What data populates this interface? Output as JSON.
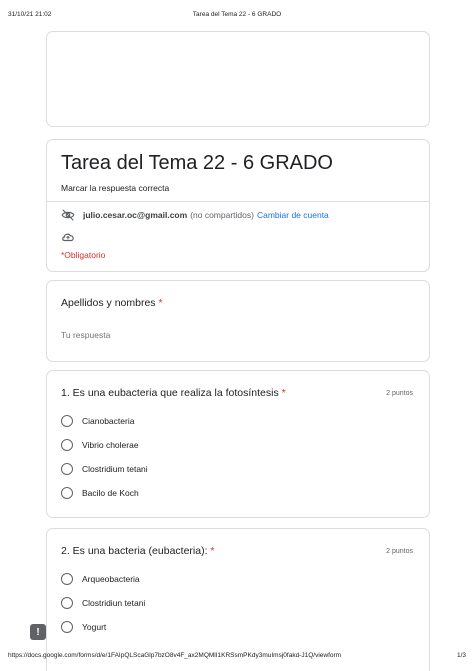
{
  "print_header": {
    "datetime": "31/10/21 21:02",
    "doc_title": "Tarea del Tema 22 - 6 GRADO"
  },
  "form": {
    "title": "Tarea del Tema 22 - 6 GRADO",
    "description": "Marcar la respuesta correcta",
    "account_email": "julio.cesar.oc@gmail.com",
    "not_shared": "(no compartidos)",
    "switch_account": "Cambiar de cuenta",
    "required_note": "*Obligatorio"
  },
  "questions": [
    {
      "title": "Apellidos y nombres",
      "required_mark": "*",
      "placeholder": "Tu respuesta"
    },
    {
      "title": "1. Es una eubacteria que realiza la fotosíntesis",
      "required_mark": "*",
      "points": "2 puntos",
      "options": [
        "Cianobacteria",
        "Vibrio cholerae",
        "Clostridium tetani",
        "Bacilo de Koch"
      ]
    },
    {
      "title": "2. Es una bacteria (eubacteria):",
      "required_mark": "*",
      "points": "2 puntos",
      "options": [
        "Arqueobacteria",
        "Clostridiun tetani",
        "Yogurt"
      ]
    }
  ],
  "print_footer": {
    "url": "https://docs.google.com/forms/d/e/1FAIpQLScaGlp7bzO8v4F_ax2MQMlI1KRSsmPKdy3muImsj0fakd-J1Q/viewform",
    "page": "1/3"
  },
  "icons": {
    "email_visibility": "eye-off-icon",
    "save_status": "cloud-icon",
    "feedback": "feedback-icon"
  },
  "colors": {
    "link": "#1a73e8",
    "required": "#d93025",
    "border": "#dadce0"
  }
}
